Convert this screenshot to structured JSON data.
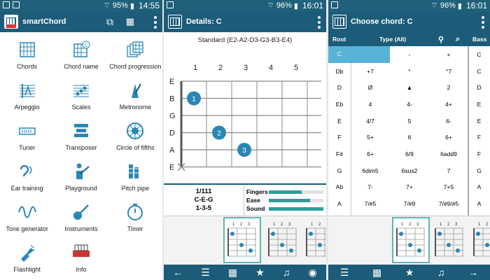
{
  "p1": {
    "status_time": "14:55",
    "status_battery": "95%",
    "app_title": "smartChord",
    "tiles": [
      {
        "label": "Chords",
        "icon": "chords-icon"
      },
      {
        "label": "Chord name",
        "icon": "chord-name-icon"
      },
      {
        "label": "Chord progression",
        "icon": "chord-progression-icon"
      },
      {
        "label": "Arpeggio",
        "icon": "arpeggio-icon"
      },
      {
        "label": "Scales",
        "icon": "scales-icon"
      },
      {
        "label": "Metronome",
        "icon": "metronome-icon"
      },
      {
        "label": "Tuner",
        "icon": "tuner-icon"
      },
      {
        "label": "Transposer",
        "icon": "transposer-icon"
      },
      {
        "label": "Circle of fifths",
        "icon": "circle-of-fifths-icon"
      },
      {
        "label": "Ear training",
        "icon": "ear-icon"
      },
      {
        "label": "Playground",
        "icon": "guitar-player-icon"
      },
      {
        "label": "Pitch pipe",
        "icon": "pitch-pipe-icon"
      },
      {
        "label": "Tone generator",
        "icon": "wave-icon"
      },
      {
        "label": "Instruments",
        "icon": "guitar-icon"
      },
      {
        "label": "Timer",
        "icon": "timer-icon"
      },
      {
        "label": "Flashlight",
        "icon": "flashlight-icon"
      },
      {
        "label": "Info",
        "icon": "info-logo-icon"
      }
    ]
  },
  "p2": {
    "status_time": "16:01",
    "status_battery": "96%",
    "title": "Details: C",
    "tuning": "Standard (E2-A2-D3-G3-B3-E4)",
    "fret_numbers": [
      "1",
      "2",
      "3",
      "4",
      "5"
    ],
    "strings": [
      "E",
      "B",
      "G",
      "D",
      "A",
      "E"
    ],
    "dots": [
      {
        "string": 1,
        "fret": 1,
        "finger": "1"
      },
      {
        "string": 3,
        "fret": 2,
        "finger": "2"
      },
      {
        "string": 4,
        "fret": 3,
        "finger": "3"
      }
    ],
    "muted_string": "E",
    "info_lines": [
      "1/111",
      "C-E-G",
      "1-3-5"
    ],
    "ratings": [
      {
        "label": "Fingers",
        "value": 0.6
      },
      {
        "label": "Ease",
        "value": 0.75
      },
      {
        "label": "Sound",
        "value": 1.0
      }
    ]
  },
  "p3": {
    "status_time": "16:01",
    "status_battery": "96%",
    "title": "Choose chord: C",
    "headers": {
      "root": "Root",
      "type": "Type (All)",
      "bass": "Bass"
    },
    "roots": [
      "C",
      "Db",
      "D",
      "Eb",
      "E",
      "F",
      "F#",
      "G",
      "Ab",
      "A"
    ],
    "types": [
      [
        "",
        "-",
        "+"
      ],
      [
        "+7",
        "°",
        "°7"
      ],
      [
        "Ø",
        "▲",
        "2"
      ],
      [
        "4",
        "4-",
        "4+"
      ],
      [
        "4/7",
        "5",
        "6-"
      ],
      [
        "5+",
        "6",
        "6+"
      ],
      [
        "6+",
        "6/9",
        "6add9"
      ],
      [
        "6dim5",
        "6sus2",
        "7"
      ],
      [
        "7-",
        "7+",
        "7+5"
      ],
      [
        "7/#5",
        "7/#9",
        "7/#9/#5"
      ]
    ],
    "bass": [
      "C",
      "C",
      "D",
      "E",
      "E",
      "F",
      "F",
      "G",
      "A",
      "A"
    ]
  },
  "colors": {
    "bar": "#1c5c78",
    "accent": "#2a87b5",
    "select": "#57b3d6"
  }
}
